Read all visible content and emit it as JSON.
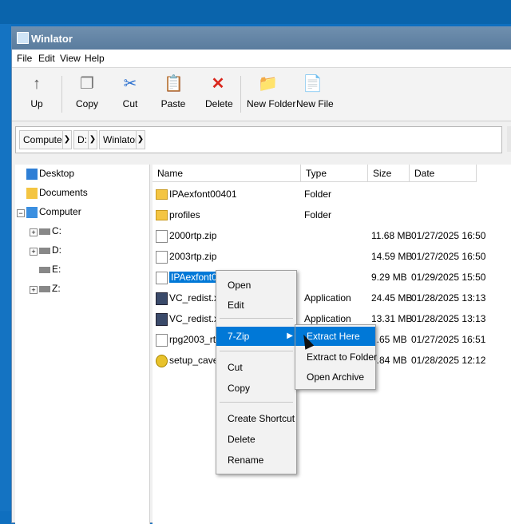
{
  "window": {
    "title": "Winlator"
  },
  "menu": [
    "File",
    "Edit",
    "View",
    "Help"
  ],
  "toolbar": [
    {
      "label": "Up",
      "icon": "up-arrow-icon"
    },
    {
      "label": "Copy",
      "icon": "copy-icon"
    },
    {
      "label": "Cut",
      "icon": "cut-icon"
    },
    {
      "label": "Paste",
      "icon": "paste-icon"
    },
    {
      "label": "Delete",
      "icon": "delete-icon"
    },
    {
      "label": "New Folder",
      "icon": "new-folder-icon"
    },
    {
      "label": "New File",
      "icon": "new-file-icon"
    }
  ],
  "breadcrumb": [
    "Computer",
    "D:",
    "Winlator"
  ],
  "tree": [
    "Desktop",
    "Documents",
    "Computer",
    "C:",
    "D:",
    "E:",
    "Z:"
  ],
  "columns": [
    "Name",
    "Type",
    "Size",
    "Date"
  ],
  "files": [
    {
      "name": "IPAexfont00401",
      "type": "Folder",
      "size": "",
      "date": ""
    },
    {
      "name": "profiles",
      "type": "Folder",
      "size": "",
      "date": ""
    },
    {
      "name": "2000rtp.zip",
      "type": "",
      "size": "11.68 MB",
      "date": "01/27/2025 16:50"
    },
    {
      "name": "2003rtp.zip",
      "type": "",
      "size": "14.59 MB",
      "date": "01/27/2025 16:50"
    },
    {
      "name": "IPAexfont0040",
      "type": "",
      "size": "9.29 MB",
      "date": "01/29/2025 15:50"
    },
    {
      "name": "VC_redist.x64.",
      "type": "Application",
      "size": "24.45 MB",
      "date": "01/28/2025 13:13"
    },
    {
      "name": "VC_redist.x86.",
      "type": "Application",
      "size": "13.31 MB",
      "date": "01/28/2025 13:13"
    },
    {
      "name": "rpg2003_rtp_ir",
      "type": "",
      "size": "2.65 MB",
      "date": "01/27/2025 16:51"
    },
    {
      "name": "setup_cavebla",
      "type": "",
      "size": "5.84 MB",
      "date": "01/28/2025 12:12"
    }
  ],
  "context_menu": {
    "items": [
      "Open",
      "Edit",
      "7-Zip",
      "Cut",
      "Copy",
      "Create Shortcut",
      "Delete",
      "Rename"
    ]
  },
  "submenu": {
    "items": [
      "Extract Here",
      "Extract to Folder",
      "Open Archive"
    ]
  },
  "colors": {
    "selection": "#0078d7",
    "titlebar": "#5a7c9e"
  }
}
